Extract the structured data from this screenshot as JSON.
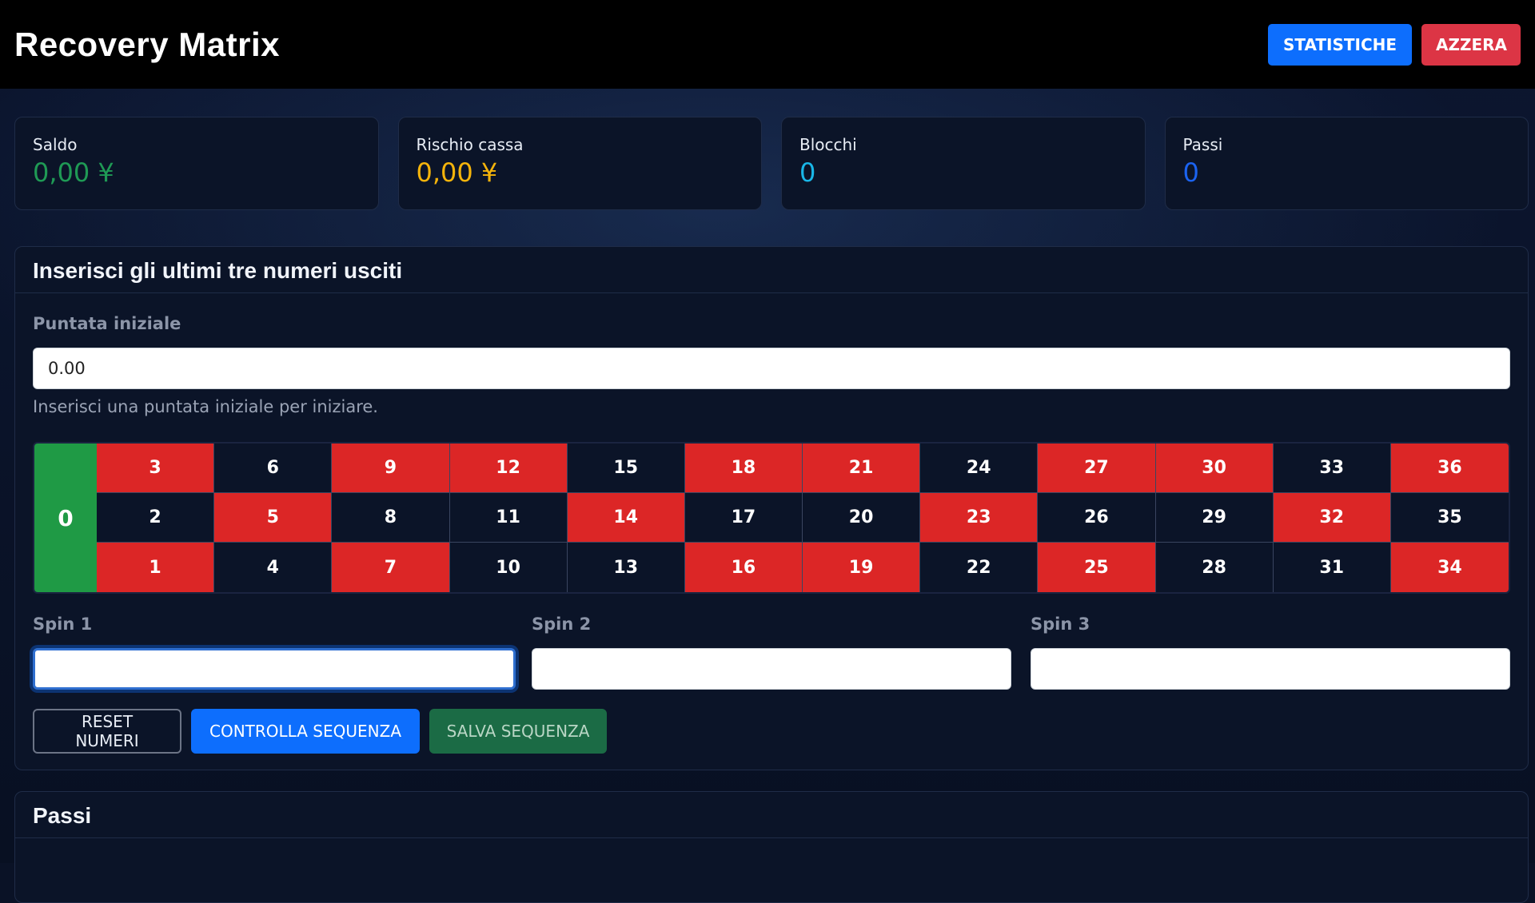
{
  "header": {
    "title": "Recovery Matrix",
    "stats_button": "STATISTICHE",
    "reset_button": "AZZERA"
  },
  "stats": [
    {
      "label": "Saldo",
      "value": "0,00 ¥",
      "color": "#1f9a55"
    },
    {
      "label": "Rischio cassa",
      "value": "0,00 ¥",
      "color": "#f5b40b"
    },
    {
      "label": "Blocchi",
      "value": "0",
      "color": "#19b7e8"
    },
    {
      "label": "Passi",
      "value": "0",
      "color": "#1b63f0"
    }
  ],
  "main": {
    "title": "Inserisci gli ultimi tre numeri usciti",
    "initial_bet_label": "Puntata iniziale",
    "initial_bet_value": "0.00",
    "help": "Inserisci una puntata iniziale per iniziare.",
    "zero": "0",
    "rows": [
      [
        {
          "n": "3",
          "c": "red"
        },
        {
          "n": "6",
          "c": "black"
        },
        {
          "n": "9",
          "c": "red"
        },
        {
          "n": "12",
          "c": "red"
        },
        {
          "n": "15",
          "c": "black"
        },
        {
          "n": "18",
          "c": "red"
        },
        {
          "n": "21",
          "c": "red"
        },
        {
          "n": "24",
          "c": "black"
        },
        {
          "n": "27",
          "c": "red"
        },
        {
          "n": "30",
          "c": "red"
        },
        {
          "n": "33",
          "c": "black"
        },
        {
          "n": "36",
          "c": "red"
        }
      ],
      [
        {
          "n": "2",
          "c": "black"
        },
        {
          "n": "5",
          "c": "red"
        },
        {
          "n": "8",
          "c": "black"
        },
        {
          "n": "11",
          "c": "black"
        },
        {
          "n": "14",
          "c": "red"
        },
        {
          "n": "17",
          "c": "black"
        },
        {
          "n": "20",
          "c": "black"
        },
        {
          "n": "23",
          "c": "red"
        },
        {
          "n": "26",
          "c": "black"
        },
        {
          "n": "29",
          "c": "black"
        },
        {
          "n": "32",
          "c": "red"
        },
        {
          "n": "35",
          "c": "black"
        }
      ],
      [
        {
          "n": "1",
          "c": "red"
        },
        {
          "n": "4",
          "c": "black"
        },
        {
          "n": "7",
          "c": "red"
        },
        {
          "n": "10",
          "c": "black"
        },
        {
          "n": "13",
          "c": "black"
        },
        {
          "n": "16",
          "c": "red"
        },
        {
          "n": "19",
          "c": "red"
        },
        {
          "n": "22",
          "c": "black"
        },
        {
          "n": "25",
          "c": "red"
        },
        {
          "n": "28",
          "c": "black"
        },
        {
          "n": "31",
          "c": "black"
        },
        {
          "n": "34",
          "c": "red"
        }
      ]
    ],
    "spins": [
      {
        "label": "Spin 1",
        "value": ""
      },
      {
        "label": "Spin 2",
        "value": ""
      },
      {
        "label": "Spin 3",
        "value": ""
      }
    ],
    "buttons": {
      "reset": "RESET NUMERI",
      "check": "CONTROLLA SEQUENZA",
      "save": "SALVA SEQUENZA"
    }
  },
  "steps": {
    "title": "Passi"
  }
}
